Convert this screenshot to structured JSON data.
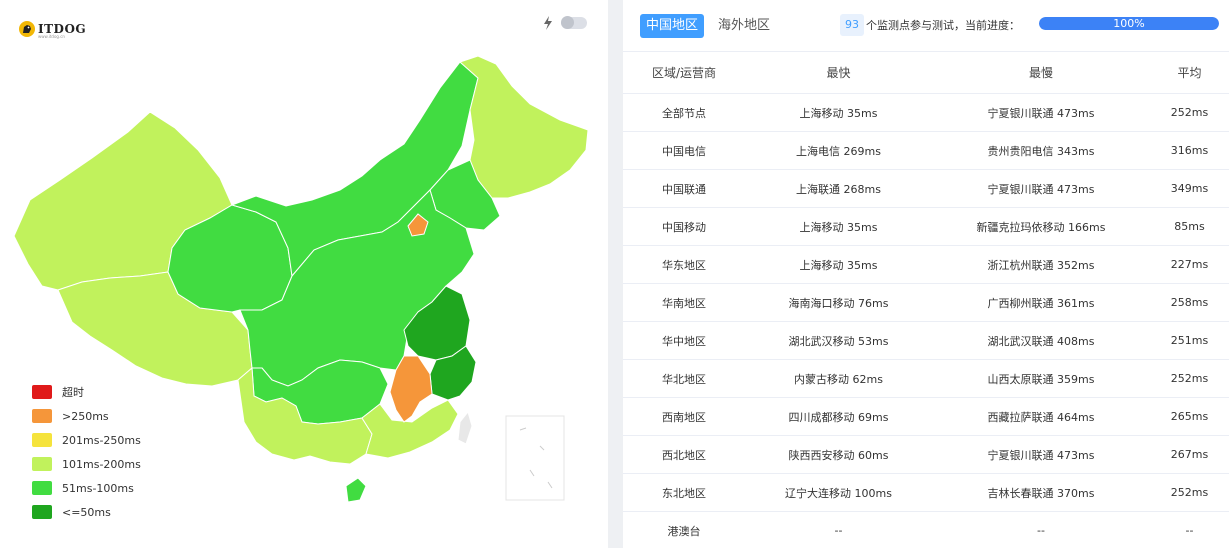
{
  "brand": {
    "name": "ITDOG",
    "tagline": "www.itdog.cn"
  },
  "colors": {
    "timeout": "#e01a1a",
    "over250": "#f5963a",
    "r201_250": "#f5e33c",
    "r101_200": "#c1f25c",
    "r51_100": "#41dc41",
    "le50": "#1fa61f",
    "accent": "#409eff"
  },
  "legend": [
    {
      "label": "超时",
      "color": "#e01a1a"
    },
    {
      "label": ">250ms",
      "color": "#f5963a"
    },
    {
      "label": "201ms-250ms",
      "color": "#f5e33c"
    },
    {
      "label": "101ms-200ms",
      "color": "#c1f25c"
    },
    {
      "label": "51ms-100ms",
      "color": "#41dc41"
    },
    {
      "label": "<=50ms",
      "color": "#1fa61f"
    }
  ],
  "tabs": {
    "domestic": "中国地区",
    "overseas": "海外地区"
  },
  "progress": {
    "count": "93",
    "label": "个监测点参与测试，当前进度：",
    "value": 1.0,
    "text": "100%"
  },
  "table": {
    "headers": {
      "region": "区域/运营商",
      "fastest": "最快",
      "slowest": "最慢",
      "average": "平均"
    },
    "rows": [
      {
        "region": "全部节点",
        "fastest": "上海移动 35ms",
        "slowest": "宁夏银川联通 473ms",
        "average": "252ms"
      },
      {
        "region": "中国电信",
        "fastest": "上海电信 269ms",
        "slowest": "贵州贵阳电信 343ms",
        "average": "316ms"
      },
      {
        "region": "中国联通",
        "fastest": "上海联通 268ms",
        "slowest": "宁夏银川联通 473ms",
        "average": "349ms"
      },
      {
        "region": "中国移动",
        "fastest": "上海移动 35ms",
        "slowest": "新疆克拉玛依移动 166ms",
        "average": "85ms"
      },
      {
        "region": "华东地区",
        "fastest": "上海移动 35ms",
        "slowest": "浙江杭州联通 352ms",
        "average": "227ms"
      },
      {
        "region": "华南地区",
        "fastest": "海南海口移动 76ms",
        "slowest": "广西柳州联通 361ms",
        "average": "258ms"
      },
      {
        "region": "华中地区",
        "fastest": "湖北武汉移动 53ms",
        "slowest": "湖北武汉联通 408ms",
        "average": "251ms"
      },
      {
        "region": "华北地区",
        "fastest": "内蒙古移动 62ms",
        "slowest": "山西太原联通 359ms",
        "average": "252ms"
      },
      {
        "region": "西南地区",
        "fastest": "四川成都移动 69ms",
        "slowest": "西藏拉萨联通 464ms",
        "average": "265ms"
      },
      {
        "region": "西北地区",
        "fastest": "陕西西安移动 60ms",
        "slowest": "宁夏银川联通 473ms",
        "average": "267ms"
      },
      {
        "region": "东北地区",
        "fastest": "辽宁大连移动 100ms",
        "slowest": "吉林长春联通 370ms",
        "average": "252ms"
      },
      {
        "region": "港澳台",
        "fastest": "--",
        "slowest": "--",
        "average": "--"
      }
    ]
  }
}
